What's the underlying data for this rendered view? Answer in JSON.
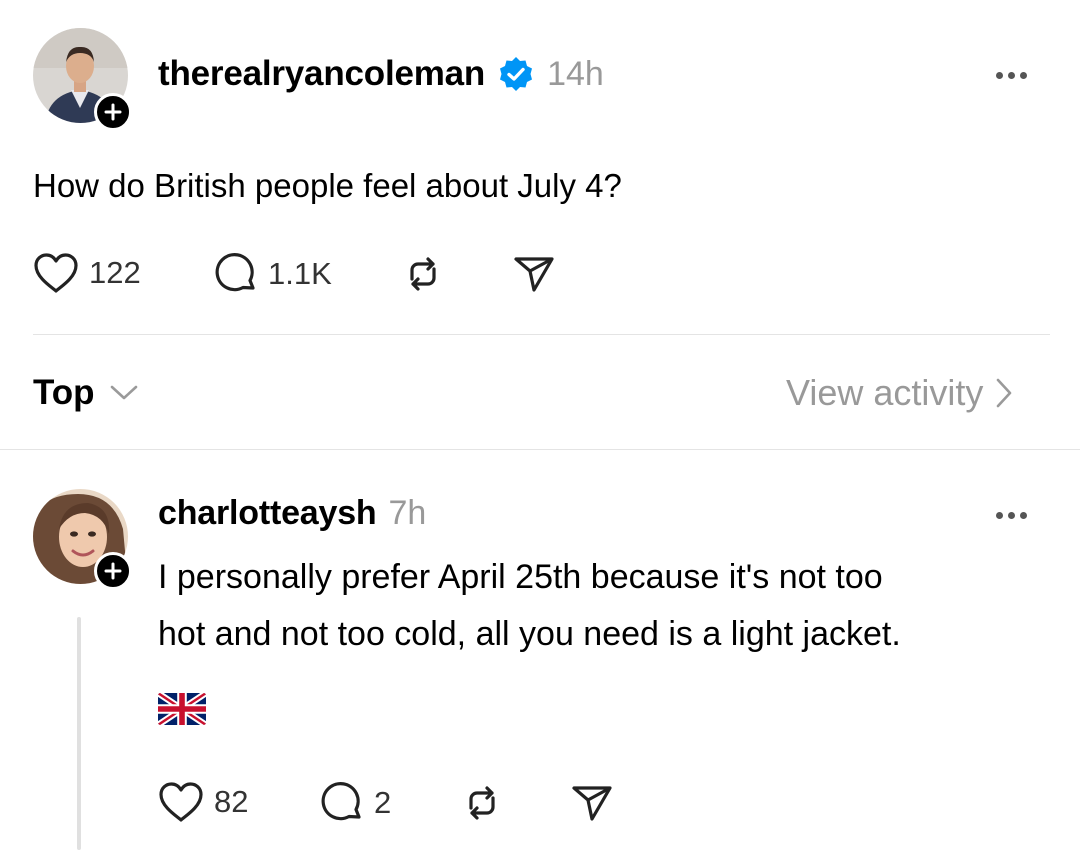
{
  "post": {
    "username": "therealryancoleman",
    "time": "14h",
    "text": "How do British people feel about July 4?",
    "likes": "122",
    "replies": "1.1K"
  },
  "sort": {
    "label": "Top",
    "view_activity": "View activity"
  },
  "reply": {
    "username": "charlotteaysh",
    "time": "7h",
    "line1": "I personally prefer April 25th because it's not too",
    "line2": "hot and not too cold, all you need is a light jacket.",
    "likes": "82",
    "replies": "2"
  },
  "colors": {
    "verified": "#0095F6",
    "muted": "#999999"
  }
}
